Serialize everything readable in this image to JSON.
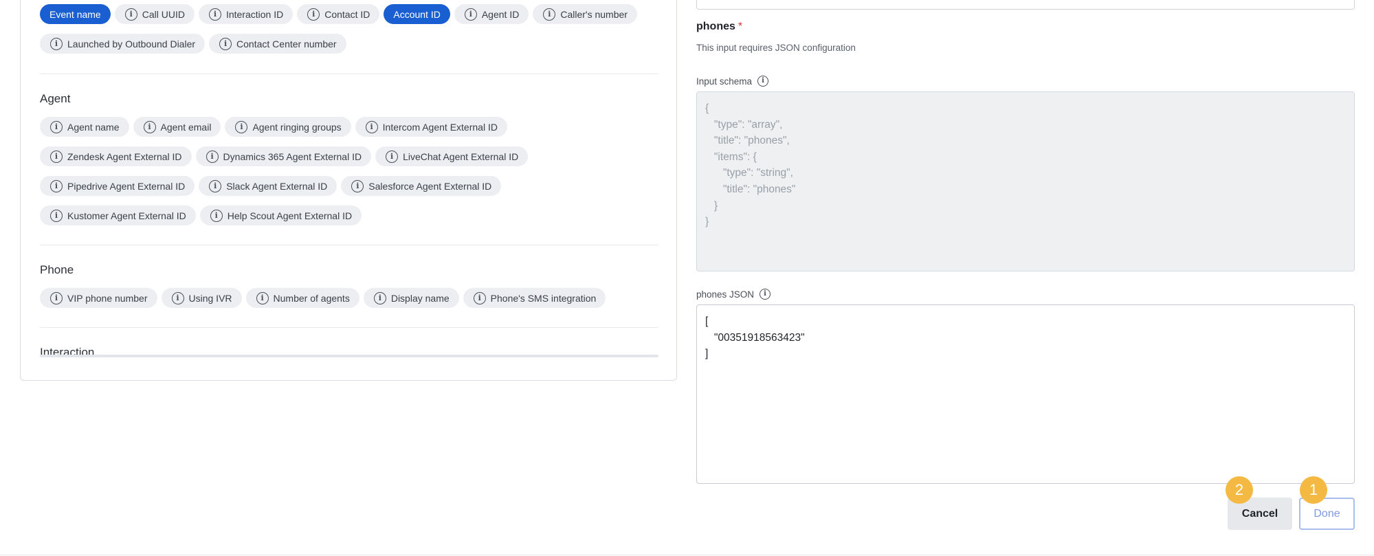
{
  "left": {
    "top_chips": [
      [
        "Event name",
        "Call UUID",
        "Interaction ID",
        "Contact ID",
        "Account ID",
        "Agent ID",
        "Caller's number"
      ],
      [
        "Launched by Outbound Dialer",
        "Contact Center number"
      ]
    ],
    "selected_chips": [
      "Event name",
      "Account ID"
    ],
    "agent": {
      "title": "Agent",
      "rows": [
        [
          "Agent name",
          "Agent email",
          "Agent ringing groups",
          "Intercom Agent External ID"
        ],
        [
          "Zendesk Agent External ID",
          "Dynamics 365 Agent External ID",
          "LiveChat Agent External ID"
        ],
        [
          "Pipedrive Agent External ID",
          "Slack Agent External ID",
          "Salesforce Agent External ID"
        ],
        [
          "Kustomer Agent External ID",
          "Help Scout Agent External ID"
        ]
      ]
    },
    "phone": {
      "title": "Phone",
      "rows": [
        [
          "VIP phone number",
          "Using IVR",
          "Number of agents",
          "Display name",
          "Phone's SMS integration"
        ]
      ]
    },
    "interaction": {
      "title": "Interaction"
    }
  },
  "right": {
    "field_label": "phones",
    "required_mark": "*",
    "hint": "This input requires JSON configuration",
    "schema_label": "Input schema",
    "schema_text": "{\n   \"type\": \"array\",\n   \"title\": \"phones\",\n   \"items\": {\n      \"type\": \"string\",\n      \"title\": \"phones\"\n   }\n}",
    "json_label": "phones JSON",
    "json_value": "[\n   \"00351918563423\"\n]"
  },
  "actions": {
    "cancel_label": "Cancel",
    "done_label": "Done",
    "cancel_badge": "2",
    "done_badge": "1"
  },
  "colors": {
    "chip_selected": "#1a5fd1",
    "badge": "#f4b942",
    "required": "#d23b3b"
  }
}
